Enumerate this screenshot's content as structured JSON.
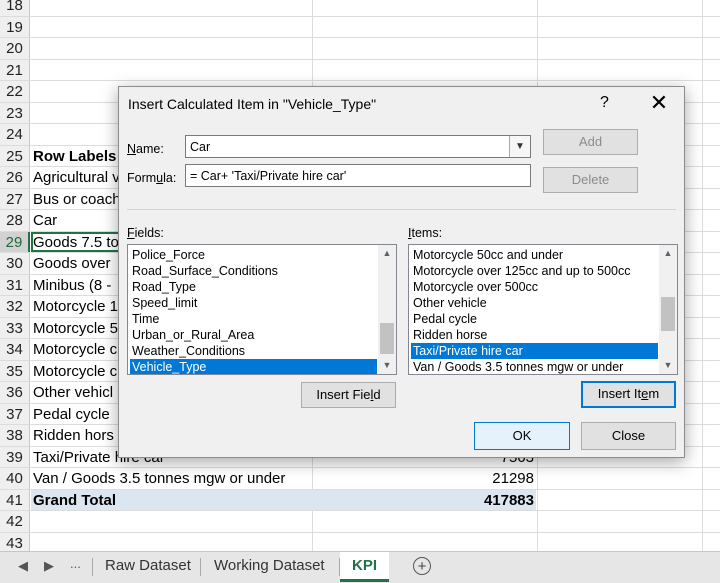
{
  "sheet": {
    "rows": [
      {
        "num": "18",
        "a": "",
        "v": ""
      },
      {
        "num": "19",
        "a": "",
        "v": ""
      },
      {
        "num": "20",
        "a": "",
        "v": ""
      },
      {
        "num": "21",
        "a": "",
        "v": ""
      },
      {
        "num": "22",
        "a": "",
        "v": ""
      },
      {
        "num": "23",
        "a": "",
        "v": ""
      },
      {
        "num": "24",
        "a": "",
        "v": ""
      },
      {
        "num": "25",
        "a": "Row Labels",
        "v": ""
      },
      {
        "num": "26",
        "a": "Agricultural v",
        "v": ""
      },
      {
        "num": "27",
        "a": "Bus or coach",
        "v": ""
      },
      {
        "num": "28",
        "a": "Car",
        "v": ""
      },
      {
        "num": "29",
        "a": "Goods 7.5 to",
        "v": ""
      },
      {
        "num": "30",
        "a": "Goods over",
        "v": ""
      },
      {
        "num": "31",
        "a": "Minibus (8 -",
        "v": ""
      },
      {
        "num": "32",
        "a": "Motorcycle 1",
        "v": ""
      },
      {
        "num": "33",
        "a": "Motorcycle 5",
        "v": ""
      },
      {
        "num": "34",
        "a": "Motorcycle c",
        "v": ""
      },
      {
        "num": "35",
        "a": "Motorcycle c",
        "v": ""
      },
      {
        "num": "36",
        "a": "Other vehicl",
        "v": ""
      },
      {
        "num": "37",
        "a": "Pedal cycle",
        "v": ""
      },
      {
        "num": "38",
        "a": "Ridden hors",
        "v": ""
      },
      {
        "num": "39",
        "a": "Taxi/Private hire car",
        "v": "7563"
      },
      {
        "num": "40",
        "a": "Van / Goods 3.5 tonnes mgw or under",
        "v": "21298"
      },
      {
        "num": "41",
        "a": "Grand Total",
        "v": "417883"
      },
      {
        "num": "42",
        "a": "",
        "v": ""
      },
      {
        "num": "43",
        "a": "",
        "v": ""
      }
    ]
  },
  "tabs": {
    "nav_prev": "◀",
    "nav_next": "▶",
    "ellipsis": "...",
    "sheets": [
      "Raw Dataset",
      "Working Dataset",
      "KPI"
    ],
    "active": "KPI",
    "add": "+"
  },
  "dialog": {
    "title": "Insert Calculated Item in \"Vehicle_Type\"",
    "help": "?",
    "close": "✕",
    "name_label": "Name:",
    "name_value": "Car",
    "formula_label": "Formula:",
    "formula_value": "= Car+ 'Taxi/Private hire car'",
    "add_button": "Add",
    "delete_button": "Delete",
    "fields_label": "Fields:",
    "fields": [
      "Police_Force",
      "Road_Surface_Conditions",
      "Road_Type",
      "Speed_limit",
      "Time",
      "Urban_or_Rural_Area",
      "Weather_Conditions",
      "Vehicle_Type"
    ],
    "fields_selected": "Vehicle_Type",
    "items_label": "Items:",
    "items": [
      "Motorcycle 50cc and under",
      "Motorcycle over 125cc and up to 500cc",
      "Motorcycle over 500cc",
      "Other vehicle",
      "Pedal cycle",
      "Ridden horse",
      "Taxi/Private hire car",
      "Van / Goods 3.5 tonnes mgw or under"
    ],
    "items_selected": "Taxi/Private hire car",
    "insert_field_button": "Insert Field",
    "insert_item_button": "Insert Item",
    "ok_button": "OK",
    "close_button": "Close"
  }
}
